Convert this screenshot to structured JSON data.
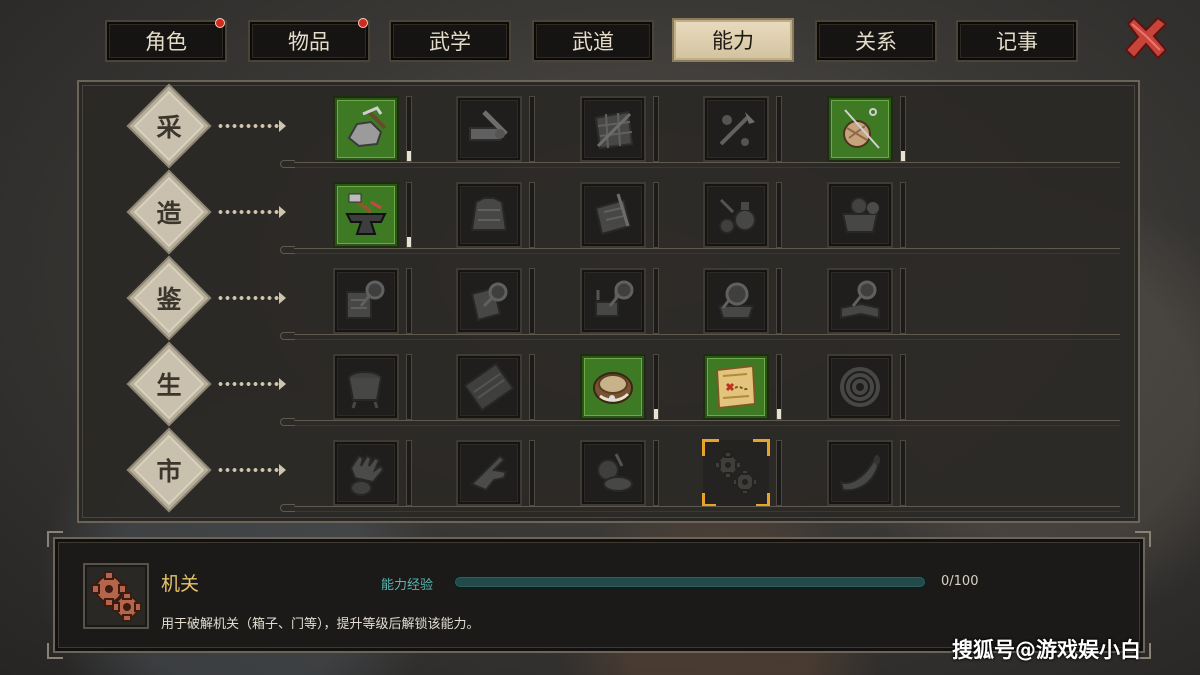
{
  "tabs": [
    {
      "label": "角色",
      "badge": true
    },
    {
      "label": "物品",
      "badge": true
    },
    {
      "label": "武学",
      "badge": false
    },
    {
      "label": "武道",
      "badge": false
    },
    {
      "label": "能力",
      "badge": false,
      "active": true
    },
    {
      "label": "关系",
      "badge": false
    },
    {
      "label": "记事",
      "badge": false
    }
  ],
  "categories": [
    {
      "label": "采",
      "skills": [
        {
          "icon": "pickaxe-ore-icon",
          "unlocked": true,
          "level": 0.15
        },
        {
          "icon": "saw-log-icon",
          "unlocked": false,
          "level": 0
        },
        {
          "icon": "fishing-net-icon",
          "unlocked": false,
          "level": 0
        },
        {
          "icon": "herb-hoe-icon",
          "unlocked": false,
          "level": 0
        },
        {
          "icon": "yarn-needle-icon",
          "unlocked": true,
          "level": 0.15
        }
      ]
    },
    {
      "label": "造",
      "skills": [
        {
          "icon": "anvil-hammer-icon",
          "unlocked": true,
          "level": 0.15
        },
        {
          "icon": "cloth-armor-icon",
          "unlocked": false,
          "level": 0
        },
        {
          "icon": "scroll-brush-icon",
          "unlocked": false,
          "level": 0
        },
        {
          "icon": "alchemy-pots-icon",
          "unlocked": false,
          "level": 0
        },
        {
          "icon": "cooking-pot-icon",
          "unlocked": false,
          "level": 0
        }
      ]
    },
    {
      "label": "鉴",
      "skills": [
        {
          "icon": "magnifier-scroll-icon",
          "unlocked": false,
          "level": 0
        },
        {
          "icon": "magnifier-armor-icon",
          "unlocked": false,
          "level": 0
        },
        {
          "icon": "magnifier-weapon-icon",
          "unlocked": false,
          "level": 0
        },
        {
          "icon": "magnifier-relic-icon",
          "unlocked": false,
          "level": 0
        },
        {
          "icon": "magnifier-book-icon",
          "unlocked": false,
          "level": 0
        }
      ]
    },
    {
      "label": "生",
      "skills": [
        {
          "icon": "cauldron-icon",
          "unlocked": false,
          "level": 0
        },
        {
          "icon": "abacus-icon",
          "unlocked": false,
          "level": 0
        },
        {
          "icon": "rope-basket-icon",
          "unlocked": true,
          "level": 0.15
        },
        {
          "icon": "treasure-map-icon",
          "unlocked": true,
          "level": 0.15
        },
        {
          "icon": "coiled-rope-icon",
          "unlocked": false,
          "level": 0
        }
      ]
    },
    {
      "label": "市",
      "skills": [
        {
          "icon": "hand-pouch-icon",
          "unlocked": false,
          "level": 0
        },
        {
          "icon": "pointing-hand-icon",
          "unlocked": false,
          "level": 0
        },
        {
          "icon": "gourd-bowl-icon",
          "unlocked": false,
          "level": 0
        },
        {
          "icon": "gears-mechanism-icon",
          "unlocked": false,
          "level": 0,
          "selected": true
        },
        {
          "icon": "horn-icon",
          "unlocked": false,
          "level": 0
        }
      ]
    }
  ],
  "info": {
    "icon": "gears-mechanism-icon",
    "name": "机关",
    "exp_label": "能力经验",
    "exp_value": "0/100",
    "exp_fraction": 0,
    "description": "用于破解机关（箱子、门等），提升等级后解锁该能力。"
  },
  "watermark": "搜狐号@游戏娱小白",
  "colors": {
    "unlocked": "#3e7a24",
    "selected": "#e8a42a",
    "exp_bar": "#5ed2c7",
    "name": "#e7c46a",
    "badge": "#d22a1e"
  }
}
